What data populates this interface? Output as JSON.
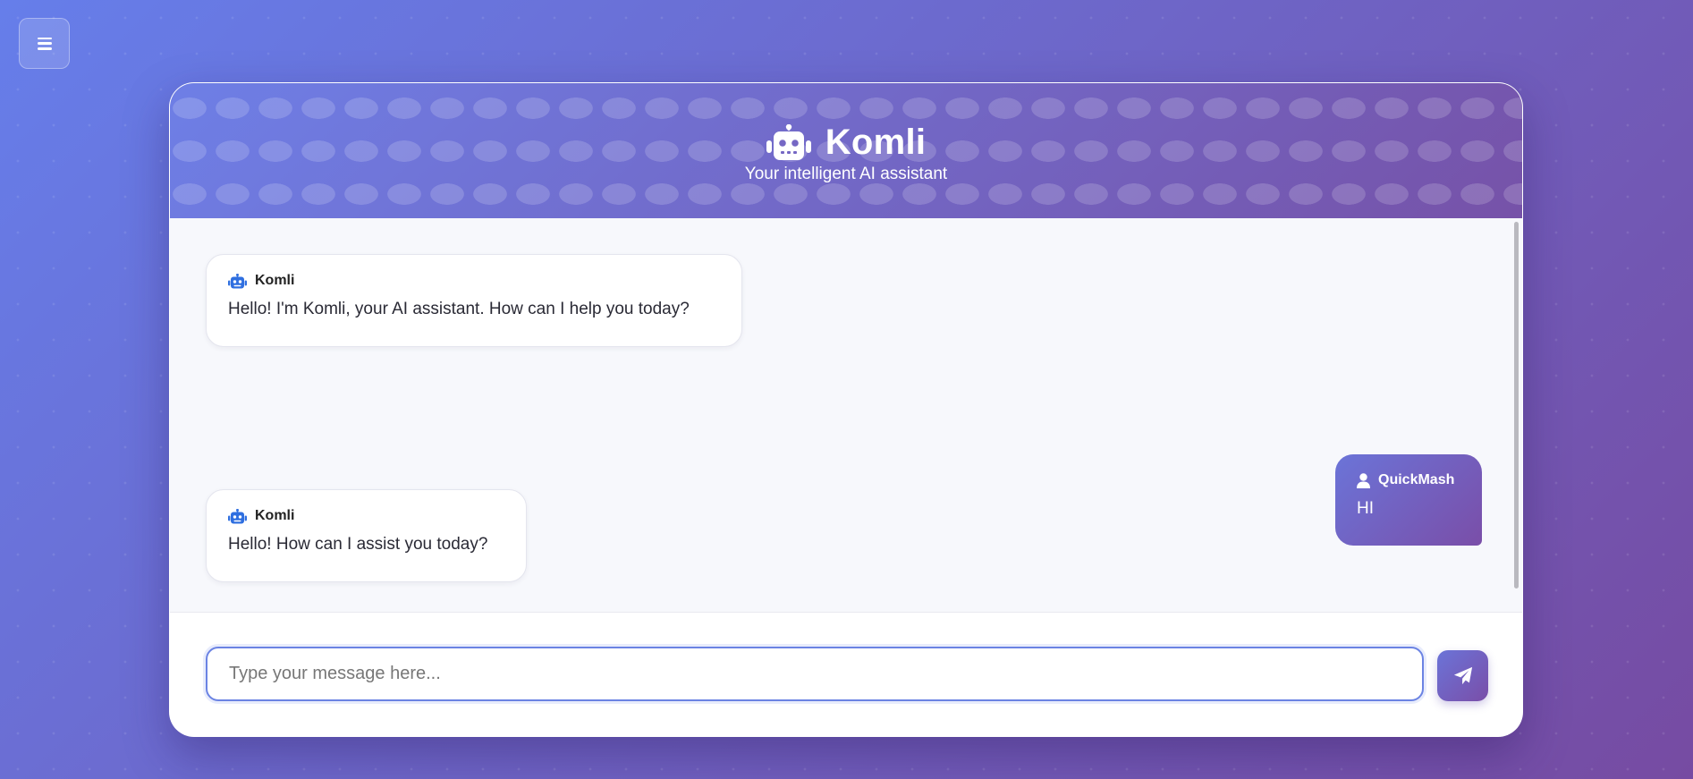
{
  "app": {
    "title": "Komli",
    "subtitle": "Your intelligent AI assistant"
  },
  "menu": {
    "icon": "hamburger-icon"
  },
  "messages": [
    {
      "sender": "Komli",
      "role": "bot",
      "icon": "robot-icon",
      "text": "Hello! I'm Komli, your AI assistant. How can I help you today?"
    },
    {
      "sender": "QuickMash",
      "role": "user",
      "icon": "user-icon",
      "text": "HI"
    },
    {
      "sender": "Komli",
      "role": "bot",
      "icon": "robot-icon",
      "text": "Hello! How can I assist you today?"
    }
  ],
  "composer": {
    "placeholder": "Type your message here...",
    "value": "",
    "send_icon": "paper-plane-icon"
  },
  "colors": {
    "accent": "#667eea",
    "accent_end": "#764ba2",
    "bot_icon": "#2f6fe0",
    "panel_bg": "#f7f8fc"
  }
}
